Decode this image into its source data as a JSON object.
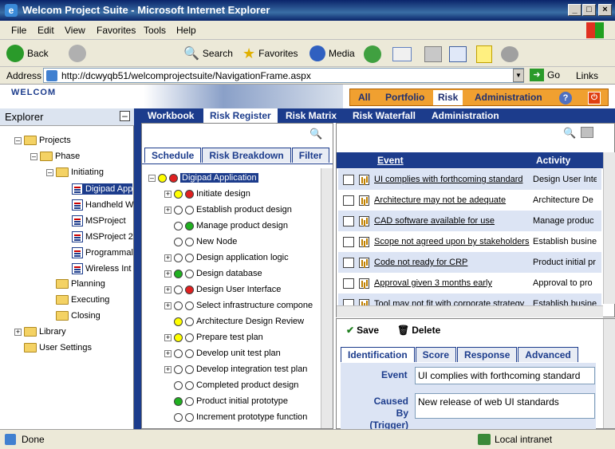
{
  "window": {
    "title": "Welcom Project Suite - Microsoft Internet Explorer"
  },
  "menu": [
    "File",
    "Edit",
    "View",
    "Favorites",
    "Tools",
    "Help"
  ],
  "toolbar": {
    "back": "Back",
    "search": "Search",
    "favorites": "Favorites",
    "media": "Media"
  },
  "address": {
    "label": "Address",
    "url": "http://dcwyqb51/welcomprojectsuite/NavigationFrame.aspx",
    "go": "Go",
    "links": "Links"
  },
  "app": {
    "logo": "WELCOM",
    "topnav": [
      "All",
      "Portfolio",
      "Risk",
      "Administration"
    ],
    "subnav": [
      "Workbook",
      "Risk Register",
      "Risk Matrix",
      "Risk Waterfall",
      "Administration"
    ]
  },
  "explorer": {
    "title": "Explorer",
    "tree": [
      "Projects",
      "Phase",
      "Initiating",
      "Digipad App",
      "Handheld W",
      "MSProject",
      "MSProject 2",
      "Programmal",
      "Wireless Int",
      "Planning",
      "Executing",
      "Closing",
      "Library",
      "User Settings"
    ]
  },
  "schedule": {
    "tabs": [
      "Schedule",
      "Risk Breakdown",
      "Filter"
    ],
    "root": "Digipad Application",
    "items": [
      {
        "name": "Initiate design",
        "c1": "y",
        "c2": "r"
      },
      {
        "name": "Establish product design",
        "c1": "w",
        "c2": "w"
      },
      {
        "name": "Manage product design",
        "c1": "w",
        "c2": "g"
      },
      {
        "name": "New Node",
        "c1": "w",
        "c2": "w"
      },
      {
        "name": "Design application logic",
        "c1": "w",
        "c2": "w"
      },
      {
        "name": "Design database",
        "c1": "g",
        "c2": "w"
      },
      {
        "name": "Design User Interface",
        "c1": "w",
        "c2": "r"
      },
      {
        "name": "Select infrastructure compone",
        "c1": "w",
        "c2": "w"
      },
      {
        "name": "Architecture Design Review",
        "c1": "y",
        "c2": "w"
      },
      {
        "name": "Prepare test plan",
        "c1": "y",
        "c2": "w"
      },
      {
        "name": "Develop unit test plan",
        "c1": "w",
        "c2": "w"
      },
      {
        "name": "Develop integration test plan",
        "c1": "w",
        "c2": "w"
      },
      {
        "name": "Completed product design",
        "c1": "w",
        "c2": "w"
      },
      {
        "name": "Product initial prototype",
        "c1": "g",
        "c2": "w"
      },
      {
        "name": "Increment prototype function",
        "c1": "w",
        "c2": "w"
      }
    ]
  },
  "risks": {
    "headers": [
      "Event",
      "Activity"
    ],
    "rows": [
      {
        "event": "UI complies with forthcoming standard",
        "activity": "Design User Inte"
      },
      {
        "event": "Architecture may not be adequate",
        "activity": "Architecture De"
      },
      {
        "event": "CAD software available for use",
        "activity": "Manage produc"
      },
      {
        "event": "Scope not agreed upon by stakeholders",
        "activity": "Establish busine"
      },
      {
        "event": "Code not ready for CRP",
        "activity": "Product initial pr"
      },
      {
        "event": "Approval given 3 months early",
        "activity": "Approval to pro"
      },
      {
        "event": "Tool may not fit with corporate strategy",
        "activity": "Establish busine"
      }
    ]
  },
  "detail": {
    "save": "Save",
    "delete": "Delete",
    "tabs": [
      "Identification",
      "Score",
      "Response",
      "Advanced"
    ],
    "event_label": "Event",
    "event_value": "UI complies with forthcoming standard",
    "cause_label": "Caused By (Trigger)",
    "cause_value": "New release of web UI standards"
  },
  "status": {
    "left": "Done",
    "right": "Local intranet"
  }
}
